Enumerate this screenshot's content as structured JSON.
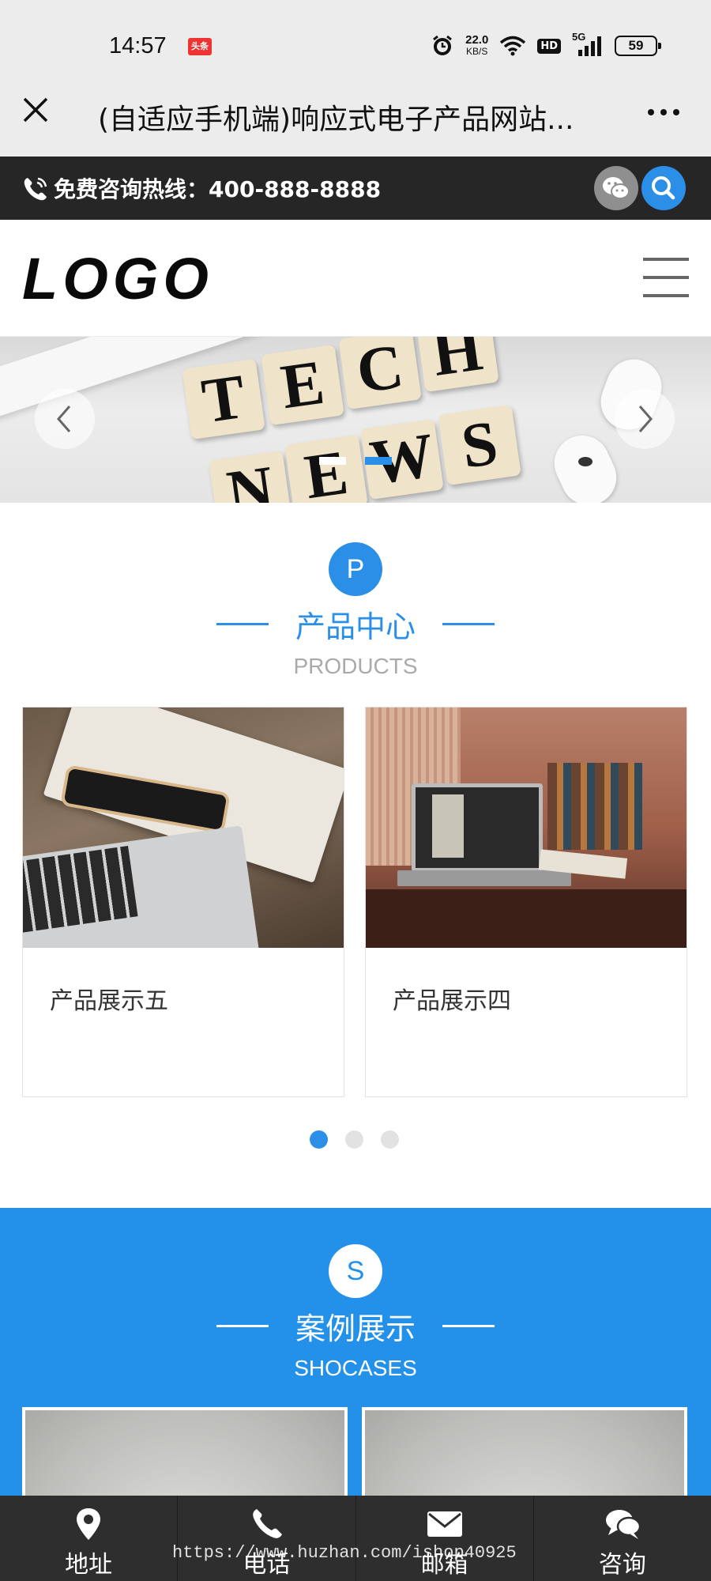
{
  "status_bar": {
    "time": "14:57",
    "app_badge": "头条",
    "network_speed": "22.0",
    "network_speed_unit": "KB/S",
    "hd": "HD",
    "signal": "5G",
    "battery": "59"
  },
  "title_bar": {
    "title": "(自适应手机端)响应式电子产品网站..."
  },
  "hotline": {
    "text": "免费咨询热线：400-888-8888"
  },
  "header": {
    "logo": "LOGO"
  },
  "banner": {
    "tiles_top": [
      "T",
      "E",
      "C",
      "H"
    ],
    "tiles_bottom": [
      "N",
      "E",
      "W",
      "S"
    ]
  },
  "products": {
    "badge": "P",
    "title": "产品中心",
    "subtitle": "PRODUCTS",
    "items": [
      {
        "label": "产品展示五"
      },
      {
        "label": "产品展示四"
      }
    ]
  },
  "cases": {
    "badge": "S",
    "title": "案例展示",
    "subtitle": "SHOCASES"
  },
  "bottom_nav": {
    "items": [
      {
        "label": "地址",
        "icon": "map-pin-icon"
      },
      {
        "label": "电话",
        "icon": "phone-icon"
      },
      {
        "label": "邮箱",
        "icon": "mail-icon"
      },
      {
        "label": "咨询",
        "icon": "chat-icon"
      }
    ]
  },
  "watermark": "https://www.huzhan.com/ishop40925",
  "colors": {
    "accent": "#2b8fe8",
    "cases_bg": "#2390ea",
    "hotline_bg": "#262626",
    "nav_bg": "#2e2e2e"
  }
}
